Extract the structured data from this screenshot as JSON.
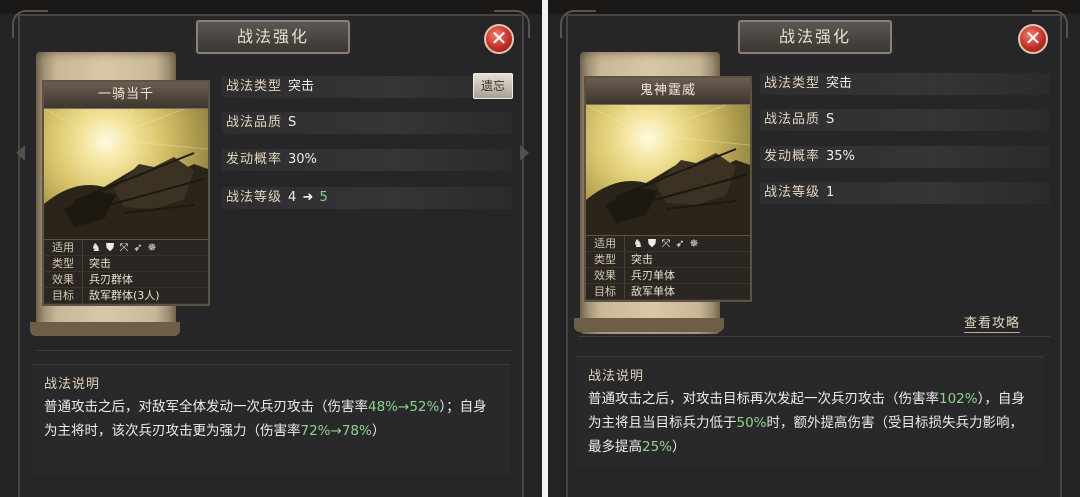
{
  "left": {
    "window_title": "战法强化",
    "close_label": "✕",
    "card": {
      "name": "一骑当千",
      "applies_label": "适用",
      "troop_icons": [
        "cavalry-icon",
        "shield-icon",
        "bow-icon",
        "spear-icon",
        "wheel-icon"
      ],
      "type_label": "类型",
      "type_value": "突击",
      "effect_label": "效果",
      "effect_value": "兵刃群体",
      "target_label": "目标",
      "target_value": "敌军群体(3人)"
    },
    "stats": {
      "type_label": "战法类型",
      "type_value": "突击",
      "quality_label": "战法品质",
      "quality_value": "S",
      "rate_label": "发动概率",
      "rate_value": "30%",
      "level_label": "战法等级",
      "level_from": "4",
      "level_arrow": "➜",
      "level_to": "5"
    },
    "forget_button": "遗忘",
    "description": {
      "title": "战法说明",
      "text_1": "普通攻击之后，对敌军全体发动一次兵刃攻击（伤害率",
      "val_1": "48%→52%",
      "text_2": "）；自身为主将时，该次兵刃攻击更为强力（伤害率",
      "val_2": "72%→78%",
      "text_3": "）"
    }
  },
  "right": {
    "window_title": "战法强化",
    "close_label": "✕",
    "card": {
      "name": "鬼神霆威",
      "applies_label": "适用",
      "troop_icons": [
        "cavalry-icon",
        "shield-icon",
        "bow-icon",
        "spear-icon",
        "wheel-icon"
      ],
      "type_label": "类型",
      "type_value": "突击",
      "effect_label": "效果",
      "effect_value": "兵刃单体",
      "target_label": "目标",
      "target_value": "敌军单体"
    },
    "stats": {
      "type_label": "战法类型",
      "type_value": "突击",
      "quality_label": "战法品质",
      "quality_value": "S",
      "rate_label": "发动概率",
      "rate_value": "35%",
      "level_label": "战法等级",
      "level_value": "1"
    },
    "guide_link": "查看攻略",
    "description": {
      "title": "战法说明",
      "text_1": "普通攻击之后，对攻击目标再次发起一次兵刃攻击（伤害率",
      "val_1": "102%",
      "text_2": "），自身为主将且当目标兵力低于",
      "val_2": "50%",
      "text_3": "时，额外提高伤害（受目标损失兵力影响，最多提高",
      "val_3": "25%",
      "text_4": "）"
    }
  },
  "colors": {
    "panel_bg": "#232325",
    "label_gold": "#e4d6bc",
    "highlight_green": "#8fd38a",
    "close_red": "#c4302a"
  }
}
